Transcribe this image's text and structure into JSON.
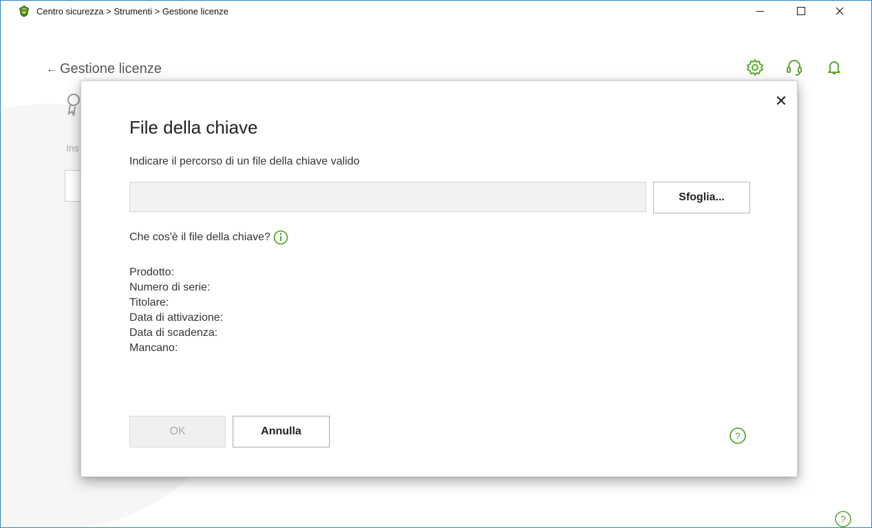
{
  "window": {
    "breadcrumb": "Centro sicurezza > Strumenti > Gestione licenze",
    "minimize_icon": "minimize-icon",
    "maximize_icon": "maximize-icon",
    "close_icon": "close-icon"
  },
  "page": {
    "back_arrow": "←",
    "title": "Gestione licenze",
    "background_text": "Ins"
  },
  "toolbar_icons": [
    "settings-gear-icon",
    "support-headset-icon",
    "notifications-bell-icon"
  ],
  "dialog": {
    "close_glyph": "✕",
    "title": "File della chiave",
    "subtitle": "Indicare il percorso di un file della chiave valido",
    "path_value": "",
    "browse_label": "Sfoglia...",
    "what_is_label": "Che cos'è il file della chiave?",
    "fields": [
      "Prodotto:",
      "Numero di serie:",
      "Titolare:",
      "Data di attivazione:",
      "Data di scadenza:",
      "Mancano:"
    ],
    "ok_label": "OK",
    "cancel_label": "Annulla"
  },
  "colors": {
    "accent_green": "#5aa52d",
    "window_border": "#2a7fd4",
    "icon_gray": "#6b9a3c"
  }
}
